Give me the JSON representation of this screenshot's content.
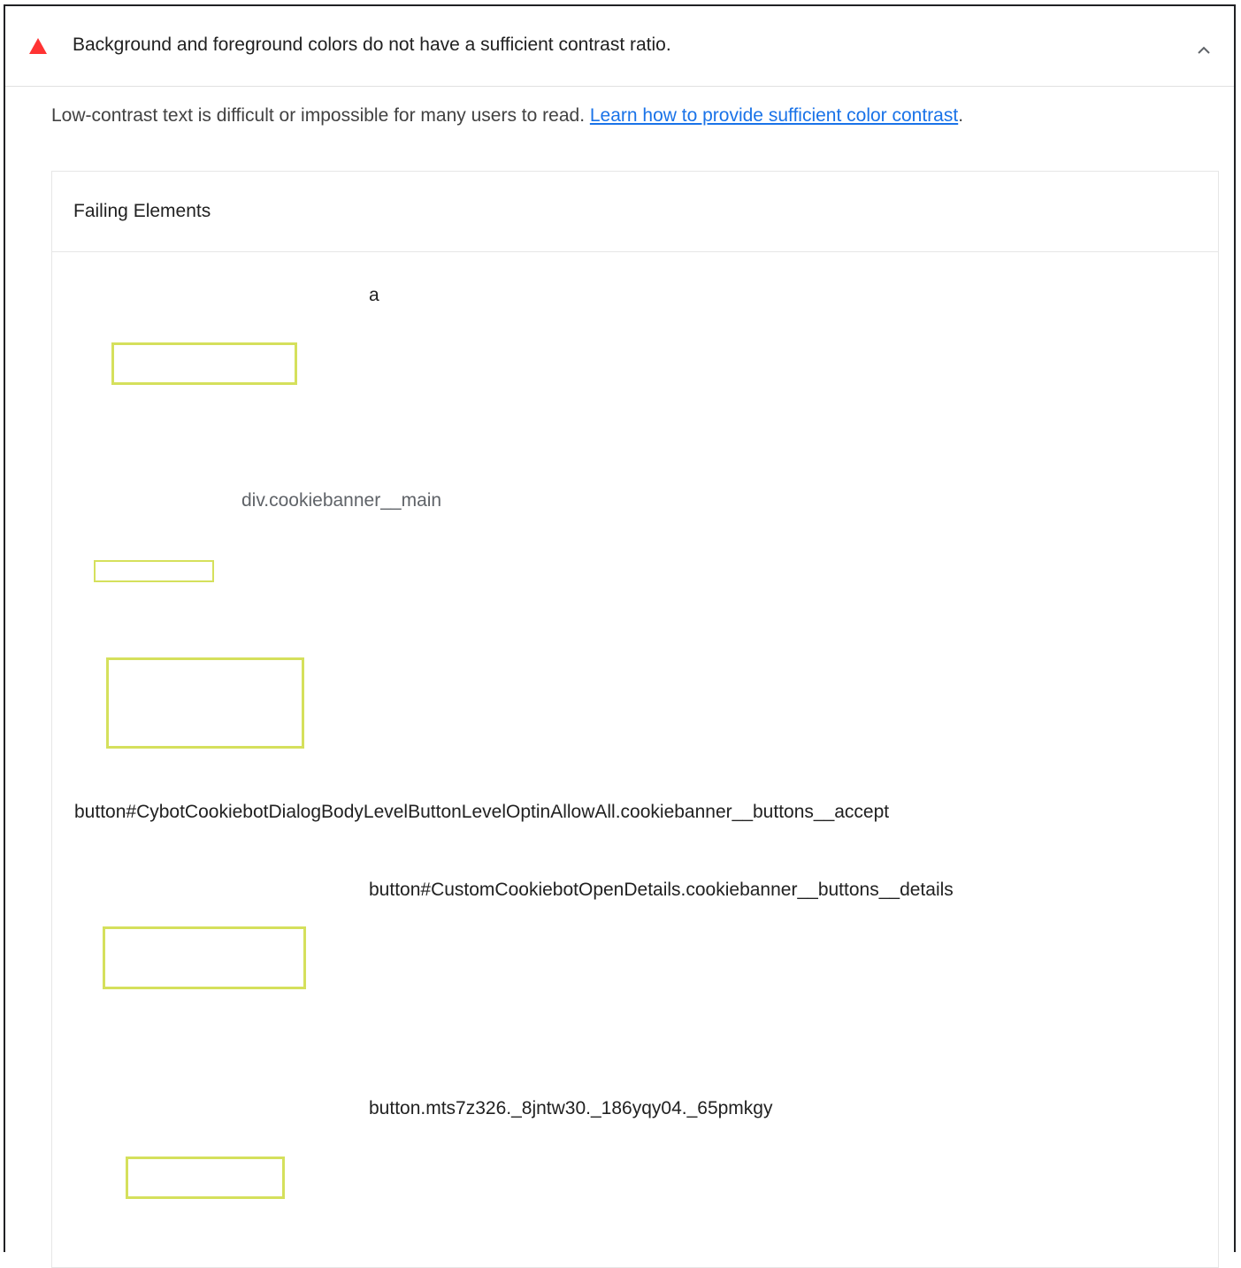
{
  "audit": {
    "title": "Background and foreground colors do not have a sufficient contrast ratio.",
    "status_icon": "fail-triangle-icon",
    "status_color": "#ff3333",
    "expanded_icon": "chevron-up-icon"
  },
  "description": {
    "text": "Low-contrast text is difficult or impossible for many users to read. ",
    "link_text": "Learn how to provide sufficient color contrast",
    "trailing": "."
  },
  "table": {
    "header": "Failing Elements",
    "items": [
      {
        "label": "a"
      },
      {
        "label": "div.cookiebanner__main"
      },
      {
        "label": "button#CybotCookiebotDialogBodyLevelButtonLevelOptinAllowAll.cookiebanner__buttons__accept"
      },
      {
        "label": "button#CustomCookiebotOpenDetails.cookiebanner__buttons__details"
      },
      {
        "label": "button.mts7z326._8jntw30._186yqy04._65pmkgy"
      }
    ]
  },
  "colors": {
    "highlight_border": "#d5e05c",
    "link": "#1a73e8"
  }
}
